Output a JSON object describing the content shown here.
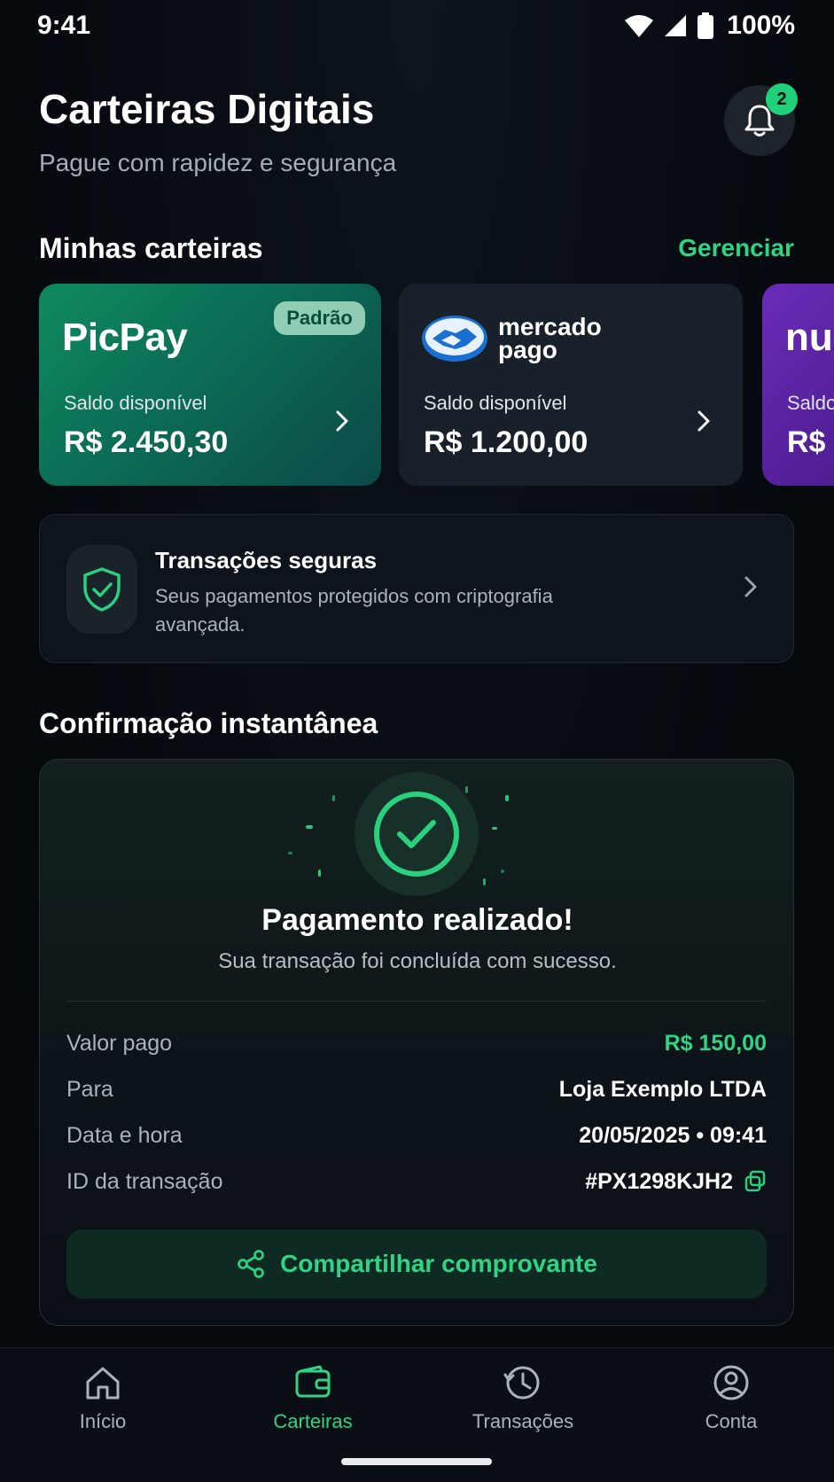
{
  "status_bar": {
    "time": "9:41",
    "battery": "100%"
  },
  "header": {
    "title": "Carteiras Digitais",
    "subtitle": "Pague com rapidez e segurança",
    "notification_count": "2"
  },
  "wallets_section": {
    "title": "Minhas carteiras",
    "manage_label": "Gerenciar"
  },
  "wallets": [
    {
      "brand": "PicPay",
      "badge": "Padrão",
      "label": "Saldo disponível",
      "balance": "R$ 2.450,30"
    },
    {
      "brand_line1": "mercado",
      "brand_line2": "pago",
      "label": "Saldo disponível",
      "balance": "R$ 1.200,00"
    },
    {
      "brand": "nu",
      "label": "Saldo",
      "balance": "R$"
    }
  ],
  "secure": {
    "title": "Transações seguras",
    "description": "Seus pagamentos protegidos com criptografia avançada."
  },
  "confirmation": {
    "section_title": "Confirmação instantânea",
    "title": "Pagamento realizado!",
    "subtitle": "Sua transação foi concluída com sucesso.",
    "rows": [
      {
        "label": "Valor pago",
        "value": "R$ 150,00"
      },
      {
        "label": "Para",
        "value": "Loja Exemplo LTDA"
      },
      {
        "label": "Data e hora",
        "value": "20/05/2025 • 09:41"
      },
      {
        "label": "ID da transação",
        "value": "#PX1298KJH2"
      }
    ],
    "share_label": "Compartilhar comprovante"
  },
  "nav": [
    {
      "label": "Início",
      "icon": "home-icon"
    },
    {
      "label": "Carteiras",
      "icon": "wallet-icon",
      "active": true
    },
    {
      "label": "Transações",
      "icon": "history-icon"
    },
    {
      "label": "Conta",
      "icon": "user-icon"
    }
  ],
  "colors": {
    "accent": "#2fd585",
    "background": "#070b11",
    "picpay": "#0f8a5f",
    "nubank": "#6a2bb8",
    "card": "#182029"
  }
}
